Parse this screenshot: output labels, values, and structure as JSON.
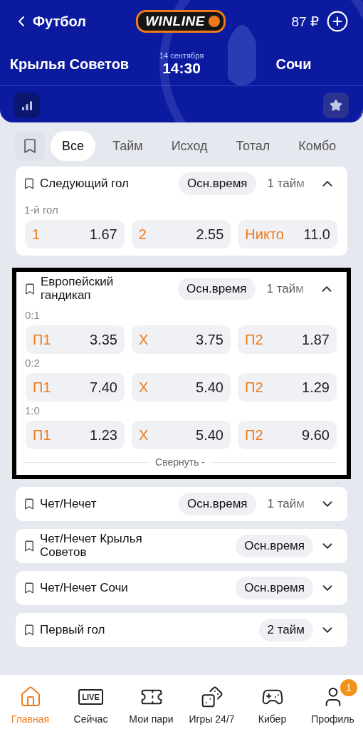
{
  "header": {
    "back_label": "Футбол",
    "logo": "WINLINE",
    "balance": "87 ₽",
    "home_team": "Крылья Советов",
    "away_team": "Сочи",
    "date": "14 сентября",
    "time": "14:30"
  },
  "tabs": [
    {
      "label": "Все",
      "selected": true
    },
    {
      "label": "Тайм",
      "selected": false
    },
    {
      "label": "Исход",
      "selected": false
    },
    {
      "label": "Тотал",
      "selected": false
    },
    {
      "label": "Комбо",
      "selected": false
    }
  ],
  "markets": [
    {
      "title": "Следующий гол",
      "highlighted": false,
      "expanded": true,
      "periods": [
        {
          "label": "Осн.время",
          "selected": true
        },
        {
          "label": "1 тайм",
          "selected": false
        }
      ],
      "groups": [
        {
          "label": "1-й гол",
          "outcomes": [
            {
              "label": "1",
              "odds": "1.67"
            },
            {
              "label": "2",
              "odds": "2.55"
            },
            {
              "label": "Никто",
              "odds": "11.0"
            }
          ]
        }
      ]
    },
    {
      "title": "Европейский гандикап",
      "highlighted": true,
      "expanded": true,
      "periods": [
        {
          "label": "Осн.время",
          "selected": true
        },
        {
          "label": "1 тайм",
          "selected": false
        }
      ],
      "groups": [
        {
          "label": "0:1",
          "outcomes": [
            {
              "label": "П1",
              "odds": "3.35"
            },
            {
              "label": "Х",
              "odds": "3.75"
            },
            {
              "label": "П2",
              "odds": "1.87"
            }
          ]
        },
        {
          "label": "0:2",
          "outcomes": [
            {
              "label": "П1",
              "odds": "7.40"
            },
            {
              "label": "Х",
              "odds": "5.40"
            },
            {
              "label": "П2",
              "odds": "1.29"
            }
          ]
        },
        {
          "label": "1:0",
          "outcomes": [
            {
              "label": "П1",
              "odds": "1.23"
            },
            {
              "label": "Х",
              "odds": "5.40"
            },
            {
              "label": "П2",
              "odds": "9.60"
            }
          ]
        }
      ],
      "collapse_label": "Свернуть -"
    },
    {
      "title": "Чет/Нечет",
      "highlighted": false,
      "expanded": false,
      "periods": [
        {
          "label": "Осн.время",
          "selected": true
        },
        {
          "label": "1 тайм",
          "selected": false
        }
      ]
    },
    {
      "title": "Чет/Нечет  Крылья Советов",
      "highlighted": false,
      "expanded": false,
      "periods": [
        {
          "label": "Осн.время",
          "selected": true
        }
      ]
    },
    {
      "title": "Чет/Нечет  Сочи",
      "highlighted": false,
      "expanded": false,
      "periods": [
        {
          "label": "Осн.время",
          "selected": true
        }
      ]
    },
    {
      "title": "Первый гол",
      "highlighted": false,
      "expanded": false,
      "periods": [
        {
          "label": "2 тайм",
          "selected": true
        }
      ]
    }
  ],
  "nav": [
    {
      "label": "Главная",
      "selected": true
    },
    {
      "label": "Сейчас",
      "selected": false,
      "icon_text": "LIVE"
    },
    {
      "label": "Мои пари",
      "selected": false
    },
    {
      "label": "Игры 24/7",
      "selected": false
    },
    {
      "label": "Кибер",
      "selected": false
    },
    {
      "label": "Профиль",
      "selected": false,
      "badge": "1"
    }
  ]
}
